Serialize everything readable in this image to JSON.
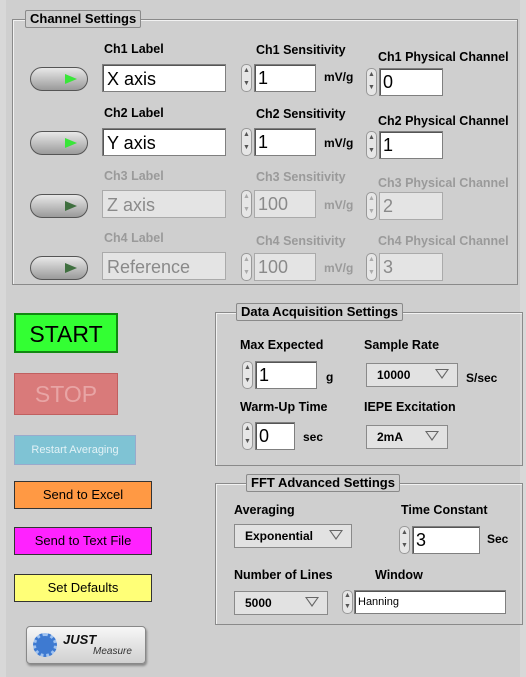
{
  "channel_settings": {
    "title": "Channel Settings",
    "channels": [
      {
        "label_title": "Ch1 Label",
        "label_value": "X axis",
        "sens_title": "Ch1 Sensitivity",
        "sens_value": "1",
        "sens_unit": "mV/g",
        "phys_title": "Ch1 Physical Channel",
        "phys_value": "0",
        "enabled": true
      },
      {
        "label_title": "Ch2 Label",
        "label_value": "Y axis",
        "sens_title": "Ch2 Sensitivity",
        "sens_value": "1",
        "sens_unit": "mV/g",
        "phys_title": "Ch2 Physical Channel",
        "phys_value": "1",
        "enabled": true
      },
      {
        "label_title": "Ch3 Label",
        "label_value": "Z axis",
        "sens_title": "Ch3 Sensitivity",
        "sens_value": "100",
        "sens_unit": "mV/g",
        "phys_title": "Ch3 Physical Channel",
        "phys_value": "2",
        "enabled": false
      },
      {
        "label_title": "Ch4 Label",
        "label_value": "Reference",
        "sens_title": "Ch4 Sensitivity",
        "sens_value": "100",
        "sens_unit": "mV/g",
        "phys_title": "Ch4 Physical Channel",
        "phys_value": "3",
        "enabled": false
      }
    ]
  },
  "buttons": {
    "start": "START",
    "stop": "STOP",
    "restart": "Restart Averaging",
    "excel": "Send to Excel",
    "textfile": "Send to Text File",
    "defaults": "Set Defaults"
  },
  "daq": {
    "title": "Data Acquisition Settings",
    "max_expected_label": "Max Expected",
    "max_expected_value": "1",
    "max_expected_unit": "g",
    "sample_rate_label": "Sample Rate",
    "sample_rate_value": "10000",
    "sample_rate_unit": "S/sec",
    "warmup_label": "Warm-Up Time",
    "warmup_value": "0",
    "warmup_unit": "sec",
    "iepe_label": "IEPE Excitation",
    "iepe_value": "2mA"
  },
  "fft": {
    "title": "FFT Advanced Settings",
    "averaging_label": "Averaging",
    "averaging_value": "Exponential",
    "time_constant_label": "Time Constant",
    "time_constant_value": "3",
    "time_constant_unit": "Sec",
    "lines_label": "Number of Lines",
    "lines_value": "5000",
    "window_label": "Window",
    "window_value": "Hanning"
  },
  "logo": {
    "brand": "JUST",
    "sub": "Measure"
  },
  "colors": {
    "start_bg": "#33ff33",
    "stop_bg": "#d97a7a",
    "restart_bg": "#7fc3d4",
    "excel_bg": "#ff9944",
    "textfile_bg": "#ff22ff",
    "defaults_bg": "#ffff77"
  }
}
